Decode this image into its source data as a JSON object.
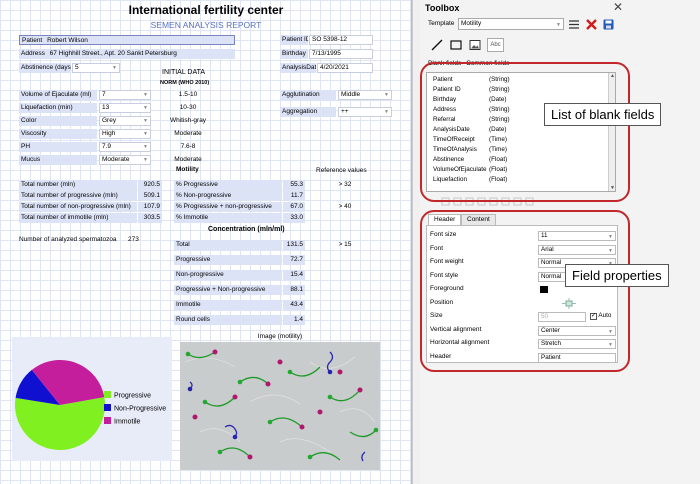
{
  "report": {
    "title": "International fertility center",
    "subtitle": "SEMEN ANALYSIS REPORT",
    "patient_label": "Patient",
    "patient_value": "Robert Wilson",
    "address_label": "Address",
    "address_value": "67 Highhill Street., Apt. 20 Sankt Petersburg",
    "abstinence_label": "Abstinence (days)",
    "abstinence_value": "5",
    "patient_id_label": "Patient ID",
    "patient_id_value": "SO 5398-12",
    "birthday_label": "Birthday",
    "birthday_value": "7/13/1995",
    "analysis_date_label": "AnalysisDate",
    "analysis_date_value": "4/20/2021",
    "initial_data": "INITIAL DATA",
    "norm_header": "NORM (WHO 2010)",
    "volume_label": "Volume of Ejaculate (ml)",
    "volume_value": "7",
    "volume_norm": "1.5-10",
    "liquefaction_label": "Liquefaction (min)",
    "liquefaction_value": "13",
    "liquefaction_norm": "10-30",
    "color_label": "Color",
    "color_value": "Grey",
    "color_norm": "Whitish-gray",
    "viscosity_label": "Viscosity",
    "viscosity_value": "High",
    "viscosity_norm": "Moderate",
    "ph_label": "PH",
    "ph_value": "7.9",
    "ph_norm": "7.6-8",
    "mucus_label": "Mucus",
    "mucus_value": "Moderate",
    "mucus_norm": "Moderate",
    "agglutination_label": "Agglutination",
    "agglutination_value": "Middle",
    "aggregation_label": "Aggregation",
    "aggregation_value": "++",
    "motility_header": "Motility",
    "reference_header": "Reference values",
    "totals": [
      {
        "label": "Total number (mln)",
        "value": "920.5"
      },
      {
        "label": "Total number of progressive (mln)",
        "value": "509.1"
      },
      {
        "label": "Total number of non-progressive (mln)",
        "value": "107.9"
      },
      {
        "label": "Total number of immotile (mln)",
        "value": "303.5"
      }
    ],
    "motility": [
      {
        "label": "% Progressive",
        "value": "55.3",
        "ref": "> 32"
      },
      {
        "label": "% Non-progressive",
        "value": "11.7",
        "ref": ""
      },
      {
        "label": "% Progressive + non-progressive",
        "value": "67.0",
        "ref": "> 40"
      },
      {
        "label": "% Immotile",
        "value": "33.0",
        "ref": ""
      }
    ],
    "analyzed_label": "Number of analyzed spermatozoa",
    "analyzed_value": "273",
    "concentration_header": "Concentration (mln/ml)",
    "concentration": [
      {
        "label": "Total",
        "value": "131.5",
        "ref": "> 15"
      },
      {
        "label": "Progressive",
        "value": "72.7",
        "ref": ""
      },
      {
        "label": "Non-progressive",
        "value": "15.4",
        "ref": ""
      },
      {
        "label": "Progressive + Non-progressive",
        "value": "88.1",
        "ref": ""
      },
      {
        "label": "Immotile",
        "value": "43.4",
        "ref": ""
      },
      {
        "label": "Round cells",
        "value": "1.4",
        "ref": ""
      }
    ],
    "image_label": "Image (motility)"
  },
  "chart_data": {
    "type": "pie",
    "labels": [
      "Progressive",
      "Non-Progressive",
      "Immotile"
    ],
    "values": [
      55.3,
      11.7,
      33.0
    ],
    "colors": [
      "#80f020",
      "#1010d0",
      "#c41e9c"
    ]
  },
  "toolbox": {
    "title": "Toolbox",
    "template_label": "Template",
    "template_value": "Motility",
    "blank_fields_label": "Blank fields",
    "blank_fields_value": "Common fields",
    "fields": [
      {
        "name": "Patient",
        "type": "(String)"
      },
      {
        "name": "Patient ID",
        "type": "(String)"
      },
      {
        "name": "Birthday",
        "type": "(Date)"
      },
      {
        "name": "Address",
        "type": "(String)"
      },
      {
        "name": "Referral",
        "type": "(String)"
      },
      {
        "name": "AnalysisDate",
        "type": "(Date)"
      },
      {
        "name": "TimeOfReceipt",
        "type": "(Time)"
      },
      {
        "name": "TimeOfAnalysis",
        "type": "(Time)"
      },
      {
        "name": "Abstinence",
        "type": "(Float)"
      },
      {
        "name": "VolumeOfEjaculate",
        "type": "(Float)"
      },
      {
        "name": "Liquefaction",
        "type": "(Float)"
      }
    ],
    "tab_header": "Header",
    "tab_content": "Content",
    "props": [
      {
        "label": "Font size",
        "value": "11"
      },
      {
        "label": "Font",
        "value": "Arial"
      },
      {
        "label": "Font weight",
        "value": "Normal"
      },
      {
        "label": "Font style",
        "value": "Normal"
      },
      {
        "label": "Foreground",
        "value": ""
      },
      {
        "label": "Position",
        "value": ""
      },
      {
        "label": "Size",
        "value": "50"
      },
      {
        "label": "Vertical alignment",
        "value": "Center"
      },
      {
        "label": "Horizontal alignment",
        "value": "Stretch"
      },
      {
        "label": "Header",
        "value": "Patient"
      }
    ],
    "size_auto": "Auto",
    "callout_fields": "List of blank fields",
    "callout_props": "Field properties"
  }
}
